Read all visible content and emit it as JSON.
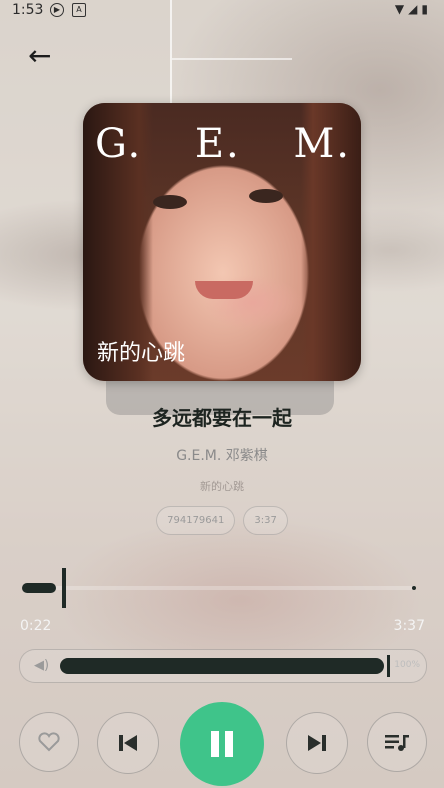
{
  "status_bar": {
    "time": "1:53"
  },
  "song": {
    "title": "多远都要在一起",
    "artist": "G.E.M. 邓紫棋",
    "album": "新的心跳",
    "chips": [
      "794179641",
      "3:37"
    ]
  },
  "album_art": {
    "brand": "G.E.M.",
    "brand_letters": [
      "G.",
      "E.",
      "M."
    ],
    "subtitle": "新的心跳"
  },
  "progress": {
    "current": "0:22",
    "total": "3:37",
    "fraction": 0.101
  },
  "volume": {
    "percent_label": "100%",
    "fraction": 0.98
  },
  "controls": {
    "prev": "prev",
    "play_pause": "pause",
    "next": "next",
    "playlist": "playlist"
  },
  "colors": {
    "accent": "#3fc48a",
    "dark": "#1f2a26"
  }
}
